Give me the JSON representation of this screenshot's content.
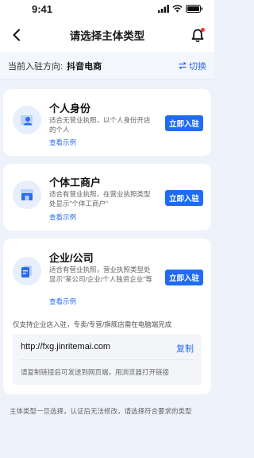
{
  "status_bar": {
    "time": "9:41"
  },
  "nav": {
    "title": "请选择主体类型"
  },
  "direction": {
    "label": "当前入驻方向:",
    "value": "抖音电商",
    "switch_label": "切换"
  },
  "cards": [
    {
      "title": "个人身份",
      "desc": "适合无营业执照，以个人身份开店的个人",
      "example": "查看示例",
      "button": "立即入驻",
      "icon": "person-id-icon"
    },
    {
      "title": "个体工商户",
      "desc": "适合有营业执照，在营业执照类型处显示\"个体工商户\"",
      "example": "查看示例",
      "button": "立即入驻",
      "icon": "storefront-icon"
    },
    {
      "title": "企业/公司",
      "desc": "适合有营业执照，营业执照类型处显示\"某公司/企业/个人独资企业\"等",
      "example": "查看示例",
      "button": "立即入驻",
      "icon": "document-icon"
    }
  ],
  "enterprise_notice": "仅支持企业店入驻，专卖/专营/旗舰店需在电脑端完成",
  "link_box": {
    "url": "http://fxg.jinritemai.com",
    "copy_label": "复制",
    "hint": "请复制链接后可发送到网页端，用浏览器打开链接"
  },
  "footer_note": "主体类型一旦选择，认证后无法修改，请选择符合要求的类型",
  "colors": {
    "accent": "#1f6cf2",
    "link": "#2a6cf0",
    "badge_red": "#f5333f"
  }
}
